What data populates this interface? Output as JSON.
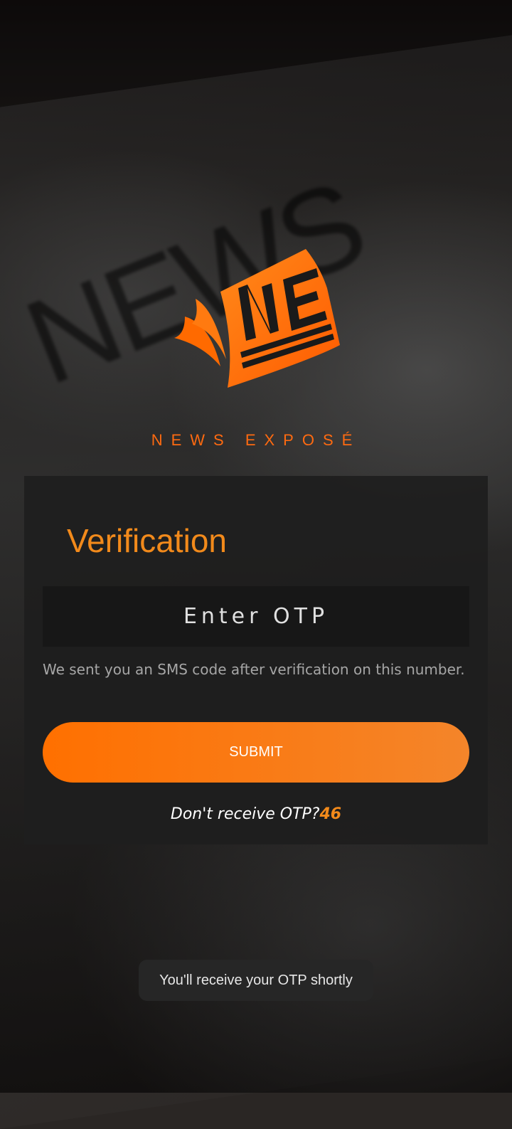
{
  "brand": {
    "logo_text": "NE",
    "name": "NEWS EXPOSÉ"
  },
  "verification": {
    "title": "Verification",
    "otp_placeholder": "Enter OTP",
    "otp_value": "",
    "info_text": "We sent you an SMS code after verification on this number.",
    "submit_label": "SUBMIT",
    "resend_prompt": "Don't receive OTP?",
    "resend_timer": "46"
  },
  "toast": {
    "message": "You'll receive your OTP shortly"
  },
  "colors": {
    "accent": "#f28a1b",
    "accent_strong": "#ff7000",
    "card_bg": "#1e1e1e"
  },
  "icons": {
    "logo": "ne-newspaper-logo"
  }
}
